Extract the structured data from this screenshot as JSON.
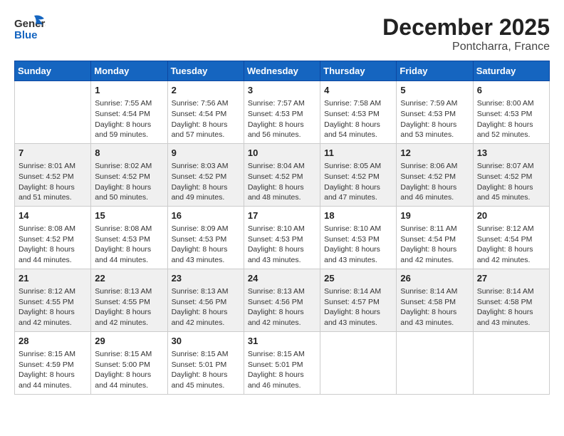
{
  "header": {
    "logo_line1": "General",
    "logo_line2": "Blue",
    "title": "December 2025",
    "subtitle": "Pontcharra, France"
  },
  "weekdays": [
    "Sunday",
    "Monday",
    "Tuesday",
    "Wednesday",
    "Thursday",
    "Friday",
    "Saturday"
  ],
  "weeks": [
    [
      {
        "day": "",
        "info": ""
      },
      {
        "day": "1",
        "info": "Sunrise: 7:55 AM\nSunset: 4:54 PM\nDaylight: 8 hours\nand 59 minutes."
      },
      {
        "day": "2",
        "info": "Sunrise: 7:56 AM\nSunset: 4:54 PM\nDaylight: 8 hours\nand 57 minutes."
      },
      {
        "day": "3",
        "info": "Sunrise: 7:57 AM\nSunset: 4:53 PM\nDaylight: 8 hours\nand 56 minutes."
      },
      {
        "day": "4",
        "info": "Sunrise: 7:58 AM\nSunset: 4:53 PM\nDaylight: 8 hours\nand 54 minutes."
      },
      {
        "day": "5",
        "info": "Sunrise: 7:59 AM\nSunset: 4:53 PM\nDaylight: 8 hours\nand 53 minutes."
      },
      {
        "day": "6",
        "info": "Sunrise: 8:00 AM\nSunset: 4:53 PM\nDaylight: 8 hours\nand 52 minutes."
      }
    ],
    [
      {
        "day": "7",
        "info": "Sunrise: 8:01 AM\nSunset: 4:52 PM\nDaylight: 8 hours\nand 51 minutes."
      },
      {
        "day": "8",
        "info": "Sunrise: 8:02 AM\nSunset: 4:52 PM\nDaylight: 8 hours\nand 50 minutes."
      },
      {
        "day": "9",
        "info": "Sunrise: 8:03 AM\nSunset: 4:52 PM\nDaylight: 8 hours\nand 49 minutes."
      },
      {
        "day": "10",
        "info": "Sunrise: 8:04 AM\nSunset: 4:52 PM\nDaylight: 8 hours\nand 48 minutes."
      },
      {
        "day": "11",
        "info": "Sunrise: 8:05 AM\nSunset: 4:52 PM\nDaylight: 8 hours\nand 47 minutes."
      },
      {
        "day": "12",
        "info": "Sunrise: 8:06 AM\nSunset: 4:52 PM\nDaylight: 8 hours\nand 46 minutes."
      },
      {
        "day": "13",
        "info": "Sunrise: 8:07 AM\nSunset: 4:52 PM\nDaylight: 8 hours\nand 45 minutes."
      }
    ],
    [
      {
        "day": "14",
        "info": "Sunrise: 8:08 AM\nSunset: 4:52 PM\nDaylight: 8 hours\nand 44 minutes."
      },
      {
        "day": "15",
        "info": "Sunrise: 8:08 AM\nSunset: 4:53 PM\nDaylight: 8 hours\nand 44 minutes."
      },
      {
        "day": "16",
        "info": "Sunrise: 8:09 AM\nSunset: 4:53 PM\nDaylight: 8 hours\nand 43 minutes."
      },
      {
        "day": "17",
        "info": "Sunrise: 8:10 AM\nSunset: 4:53 PM\nDaylight: 8 hours\nand 43 minutes."
      },
      {
        "day": "18",
        "info": "Sunrise: 8:10 AM\nSunset: 4:53 PM\nDaylight: 8 hours\nand 43 minutes."
      },
      {
        "day": "19",
        "info": "Sunrise: 8:11 AM\nSunset: 4:54 PM\nDaylight: 8 hours\nand 42 minutes."
      },
      {
        "day": "20",
        "info": "Sunrise: 8:12 AM\nSunset: 4:54 PM\nDaylight: 8 hours\nand 42 minutes."
      }
    ],
    [
      {
        "day": "21",
        "info": "Sunrise: 8:12 AM\nSunset: 4:55 PM\nDaylight: 8 hours\nand 42 minutes."
      },
      {
        "day": "22",
        "info": "Sunrise: 8:13 AM\nSunset: 4:55 PM\nDaylight: 8 hours\nand 42 minutes."
      },
      {
        "day": "23",
        "info": "Sunrise: 8:13 AM\nSunset: 4:56 PM\nDaylight: 8 hours\nand 42 minutes."
      },
      {
        "day": "24",
        "info": "Sunrise: 8:13 AM\nSunset: 4:56 PM\nDaylight: 8 hours\nand 42 minutes."
      },
      {
        "day": "25",
        "info": "Sunrise: 8:14 AM\nSunset: 4:57 PM\nDaylight: 8 hours\nand 43 minutes."
      },
      {
        "day": "26",
        "info": "Sunrise: 8:14 AM\nSunset: 4:58 PM\nDaylight: 8 hours\nand 43 minutes."
      },
      {
        "day": "27",
        "info": "Sunrise: 8:14 AM\nSunset: 4:58 PM\nDaylight: 8 hours\nand 43 minutes."
      }
    ],
    [
      {
        "day": "28",
        "info": "Sunrise: 8:15 AM\nSunset: 4:59 PM\nDaylight: 8 hours\nand 44 minutes."
      },
      {
        "day": "29",
        "info": "Sunrise: 8:15 AM\nSunset: 5:00 PM\nDaylight: 8 hours\nand 44 minutes."
      },
      {
        "day": "30",
        "info": "Sunrise: 8:15 AM\nSunset: 5:01 PM\nDaylight: 8 hours\nand 45 minutes."
      },
      {
        "day": "31",
        "info": "Sunrise: 8:15 AM\nSunset: 5:01 PM\nDaylight: 8 hours\nand 46 minutes."
      },
      {
        "day": "",
        "info": ""
      },
      {
        "day": "",
        "info": ""
      },
      {
        "day": "",
        "info": ""
      }
    ]
  ]
}
